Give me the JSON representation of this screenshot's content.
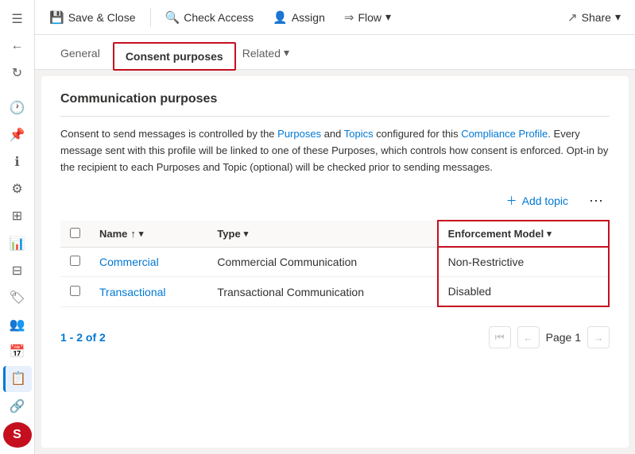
{
  "toolbar": {
    "save_close": "Save & Close",
    "check_access": "Check Access",
    "assign": "Assign",
    "flow": "Flow",
    "share": "Share"
  },
  "tabs": {
    "general": "General",
    "consent_purposes": "Consent purposes",
    "related": "Related"
  },
  "content": {
    "section_title": "Communication purposes",
    "info_text": "Consent to send messages is controlled by the Purposes and Topics configured for this Compliance Profile. Every message sent with this profile will be linked to one of these Purposes, which controls how consent is enforced. Opt-in by the recipient to each Purposes and Topic (optional) will be checked prior to sending messages.",
    "add_topic": "Add topic",
    "table": {
      "col_name": "Name",
      "col_type": "Type",
      "col_enforcement": "Enforcement Model",
      "rows": [
        {
          "name": "Commercial",
          "type": "Commercial Communication",
          "enforcement": "Non-Restrictive"
        },
        {
          "name": "Transactional",
          "type": "Transactional Communication",
          "enforcement": "Disabled"
        }
      ]
    },
    "pagination": {
      "range": "1 - 2 of 2",
      "page_label": "Page 1"
    }
  },
  "sidebar": {
    "icons": [
      {
        "name": "menu-icon",
        "glyph": "☰"
      },
      {
        "name": "back-icon",
        "glyph": "←"
      },
      {
        "name": "history-icon",
        "glyph": "🕐"
      },
      {
        "name": "pin-icon",
        "glyph": "📌"
      },
      {
        "name": "info-icon",
        "glyph": "ℹ"
      },
      {
        "name": "settings-icon",
        "glyph": "⚙"
      },
      {
        "name": "dashboard-icon",
        "glyph": "⊞"
      },
      {
        "name": "chart-icon",
        "glyph": "📊"
      },
      {
        "name": "grid-icon",
        "glyph": "⊟"
      },
      {
        "name": "tag-icon",
        "glyph": "🏷"
      },
      {
        "name": "people-icon",
        "glyph": "👥"
      },
      {
        "name": "calendar-icon",
        "glyph": "📅"
      },
      {
        "name": "active-icon",
        "glyph": "📋"
      },
      {
        "name": "link-icon",
        "glyph": "🔗"
      },
      {
        "name": "user-icon",
        "glyph": "S"
      }
    ]
  }
}
